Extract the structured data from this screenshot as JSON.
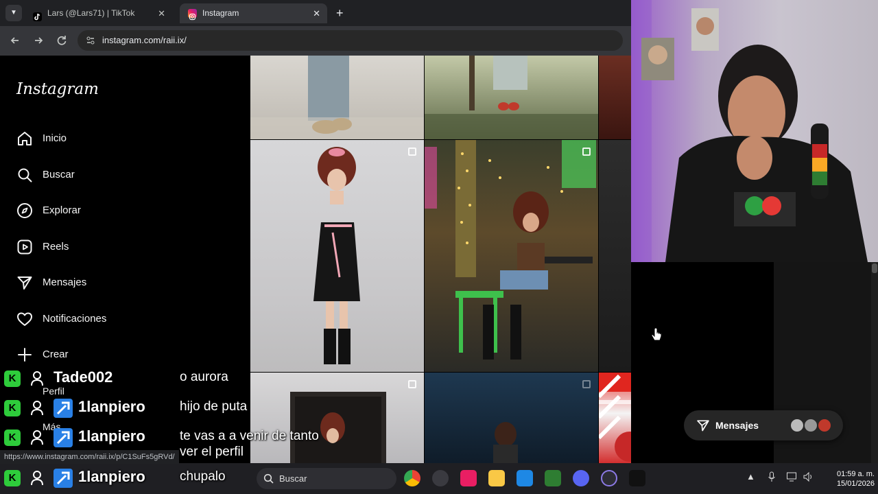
{
  "browser": {
    "tabs": [
      {
        "label": "Lars (@Lars71) | TikTok",
        "close": "✕"
      },
      {
        "label": "Instagram",
        "close": "✕"
      }
    ],
    "new_tab": "+",
    "url": "instagram.com/raii.ix/",
    "status_link": "https://www.instagram.com/raii.ix/p/C1SuFs5gRVd/"
  },
  "instagram": {
    "logo": "Instagram",
    "nav": [
      {
        "label": "Inicio",
        "icon": "home-icon"
      },
      {
        "label": "Buscar",
        "icon": "search-icon"
      },
      {
        "label": "Explorar",
        "icon": "compass-icon"
      },
      {
        "label": "Reels",
        "icon": "reels-icon"
      },
      {
        "label": "Mensajes",
        "icon": "send-icon"
      },
      {
        "label": "Notificaciones",
        "icon": "heart-icon"
      },
      {
        "label": "Crear",
        "icon": "plus-icon"
      }
    ],
    "nav_hidden": {
      "perfil": "Perfil",
      "mas": "Más"
    },
    "messages_pill": "Mensajes"
  },
  "chat": [
    {
      "user": "Tade002",
      "message": "o aurora",
      "kick_badge": false
    },
    {
      "user": "1lanpiero",
      "message": "hijo de puta",
      "kick_badge": true
    },
    {
      "user": "1lanpiero",
      "message": "te vas a a venir de tanto",
      "message_line2": "ver el perfil",
      "kick_badge": true
    },
    {
      "user": "1lanpiero",
      "message": "chupalo",
      "kick_badge": true
    }
  ],
  "chat_badge_letter": "K",
  "taskbar": {
    "search_placeholder": "Buscar",
    "time": "01:59 a. m.",
    "date": "15/01/2026"
  },
  "colors": {
    "kick_green": "#2ecc3b",
    "instagram_bg": "#000000",
    "chrome_toolbar": "#35363a"
  }
}
